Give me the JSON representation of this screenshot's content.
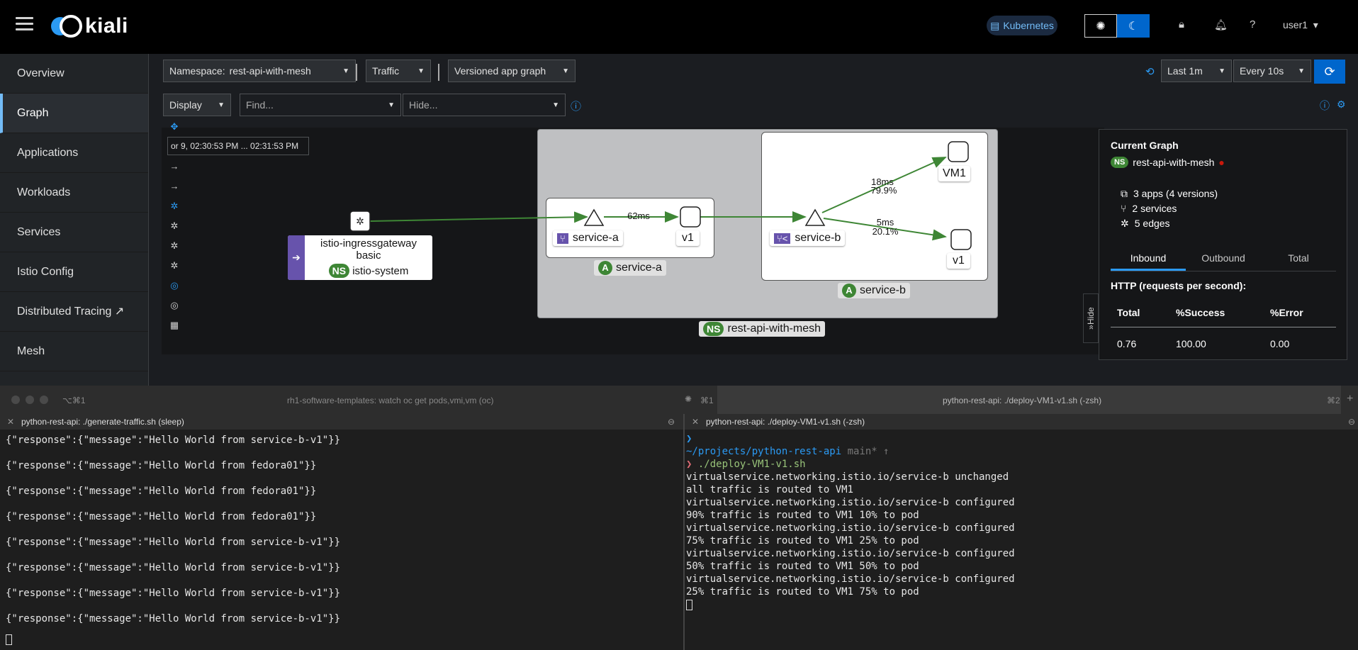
{
  "app": {
    "name": "kiali",
    "env": "Kubernetes",
    "user": "user1"
  },
  "nav": [
    "Overview",
    "Graph",
    "Applications",
    "Workloads",
    "Services",
    "Istio Config",
    "Distributed Tracing",
    "Mesh"
  ],
  "toolbar": {
    "namespace_label": "Namespace:",
    "namespace_value": "rest-api-with-mesh",
    "traffic": "Traffic",
    "graph_type": "Versioned app graph",
    "last": "Last 1m",
    "every": "Every 10s",
    "display": "Display",
    "find_placeholder": "Find...",
    "hide_placeholder": "Hide..."
  },
  "graph": {
    "timestamp": "or 9, 02:30:53 PM ... 02:31:53 PM",
    "ingress": {
      "line1": "istio-ingressgateway",
      "line2": "basic",
      "ns_badge": "NS",
      "ns": "istio-system"
    },
    "namespace_badge": "NS",
    "namespace": "rest-api-with-mesh",
    "app_badge": "A",
    "service_a": "service-a",
    "service_b": "service-b",
    "v1": "v1",
    "vm1": "VM1",
    "edge_a": "62ms",
    "edge_vm_ms": "18ms",
    "edge_vm_pct": "79.9%",
    "edge_v1_ms": "5ms",
    "edge_v1_pct": "20.1%"
  },
  "panel": {
    "title": "Current Graph",
    "ns_badge": "NS",
    "namespace": "rest-api-with-mesh",
    "apps": "3 apps (4 versions)",
    "services": "2 services",
    "edges": "5 edges",
    "tabs": [
      "Inbound",
      "Outbound",
      "Total"
    ],
    "http": "HTTP (requests per second):",
    "headers": [
      "Total",
      "%Success",
      "%Error"
    ],
    "values": [
      "0.76",
      "100.00",
      "0.00"
    ],
    "hide": "Hide"
  },
  "terminal": {
    "tab1_shortcut": "⌥⌘1",
    "tab1": "rh1-software-templates: watch oc get pods,vmi,vm (oc)",
    "tab1_key": "⌘1",
    "tab2": "python-rest-api: ./deploy-VM1-v1.sh (-zsh)",
    "tab2_key": "⌘2",
    "left_title": "python-rest-api: ./generate-traffic.sh (sleep)",
    "right_title": "python-rest-api: ./deploy-VM1-v1.sh (-zsh)",
    "left_lines": [
      "{\"response\":{\"message\":\"Hello World from service-b-v1\"}}",
      "{\"response\":{\"message\":\"Hello World from fedora01\"}}",
      "{\"response\":{\"message\":\"Hello World from fedora01\"}}",
      "{\"response\":{\"message\":\"Hello World from fedora01\"}}",
      "{\"response\":{\"message\":\"Hello World from service-b-v1\"}}",
      "{\"response\":{\"message\":\"Hello World from service-b-v1\"}}",
      "{\"response\":{\"message\":\"Hello World from service-b-v1\"}}",
      "{\"response\":{\"message\":\"Hello World from service-b-v1\"}}"
    ],
    "prompt_path": "~/projects/python-rest-api",
    "prompt_branch": "main* ↑",
    "command": "./deploy-VM1-v1.sh",
    "right_lines": [
      "virtualservice.networking.istio.io/service-b unchanged",
      "all traffic is routed to VM1",
      "virtualservice.networking.istio.io/service-b configured",
      "90% traffic is routed to VM1 10% to pod",
      "virtualservice.networking.istio.io/service-b configured",
      "75% traffic is routed to VM1 25% to pod",
      "virtualservice.networking.istio.io/service-b configured",
      "50% traffic is routed to VM1 50% to pod",
      "virtualservice.networking.istio.io/service-b configured",
      "25% traffic is routed to VM1 75% to pod"
    ]
  },
  "colors": {
    "accent": "#0066cc",
    "edge": "#3e8635",
    "purple": "#6753ac"
  },
  "icons": [
    "menu-icon",
    "kubernetes-icon",
    "sun-icon",
    "moon-icon",
    "lock-icon",
    "bell-icon",
    "help-icon",
    "refresh-icon",
    "history-icon",
    "external-link-icon",
    "info-icon",
    "gateway-icon"
  ]
}
